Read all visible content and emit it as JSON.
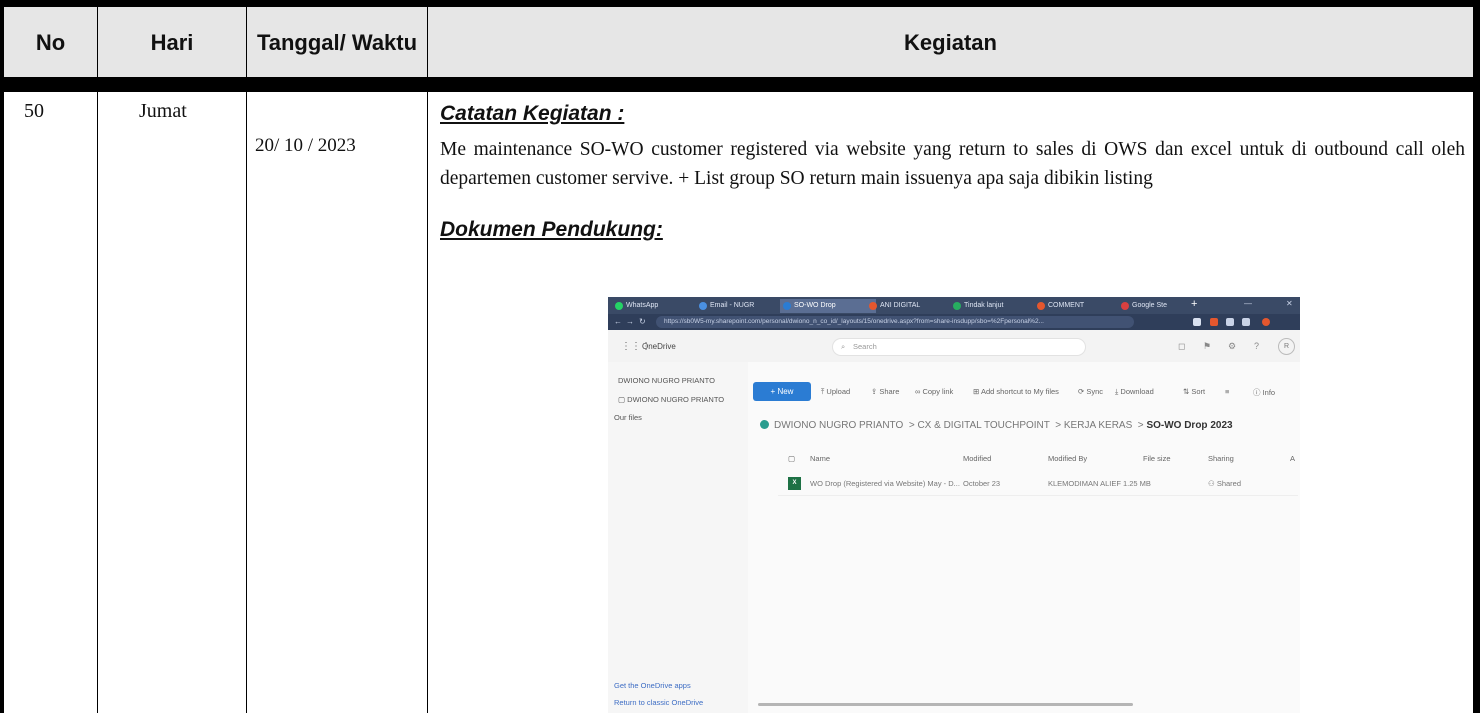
{
  "table": {
    "headers": {
      "no": "No",
      "hari": "Hari",
      "tanggal": "Tanggal/ Waktu",
      "kegiatan": "Kegiatan"
    },
    "row": {
      "no": "50",
      "hari": "Jumat",
      "tanggal": "20/ 10 / 2023",
      "catatan_heading": "Catatan Kegiatan :",
      "catatan_text": "Me maintenance SO-WO customer registered via website yang return to sales di OWS dan excel untuk di outbound call oleh departemen customer servive. + List group SO return main issuenya apa saja dibikin listing",
      "dokumen_heading": "Dokumen Pendukung:"
    }
  },
  "screenshot": {
    "tabs": [
      {
        "label": "WhatsApp",
        "color": "#25d366"
      },
      {
        "label": "Email - NUGR",
        "color": "#4a90e2"
      },
      {
        "label": "SO-WO Drop",
        "color": "#2b7cd3"
      },
      {
        "label": "ANI DIGITAL",
        "color": "#e4572e"
      },
      {
        "label": "Tindak lanjut",
        "color": "#27ae60"
      },
      {
        "label": "COMMENT",
        "color": "#e4572e"
      },
      {
        "label": "Google Ste",
        "color": "#d94040"
      }
    ],
    "url": "https://sb0W5-my.sharepoint.com/personal/dwiono_n_co_id/_layouts/15/onedrive.aspx?from=share-insdupp/sbo=%2Fpersonal%2...",
    "app_title": "OneDrive",
    "search_placeholder": "Search",
    "sidebar": {
      "user": "DWIONO NUGRO PRIANTO",
      "folder": "DWIONO NUGRO PRIANTO",
      "section": "Our files",
      "footer1": "Get the OneDrive apps",
      "footer2": "Return to classic OneDrive"
    },
    "commands": {
      "new": "+ New",
      "upload": "Upload",
      "share": "Share",
      "copy_link": "Copy link",
      "add_shortcut": "Add shortcut to My files",
      "sync": "Sync",
      "download": "Download",
      "sort": "Sort",
      "view": "≡",
      "info": "Info"
    },
    "breadcrumb": [
      "DWIONO NUGRO PRIANTO",
      "CX & DIGITAL TOUCHPOINT",
      "KERJA KERAS",
      "SO-WO Drop 2023"
    ],
    "columns": [
      "Name",
      "Modified",
      "Modified By",
      "File size",
      "Sharing",
      "A"
    ],
    "file": {
      "name": "WO Drop (Registered via Website) May - D...",
      "modified": "October 23",
      "modified_by": "KLEMODIMAN ALIEF",
      "size": "1.25 MB",
      "sharing": "Shared"
    }
  }
}
